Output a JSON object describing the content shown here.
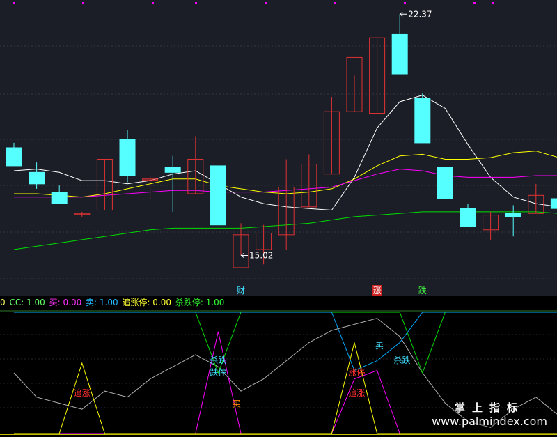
{
  "colors": {
    "background": "#000000",
    "upper_bg": "#1c1e27",
    "grid": "#353846",
    "divider": "#2e7a2e",
    "up": "#e03232",
    "down": "#55ffff",
    "ma1": "#ffffff",
    "ma2": "#ffff00",
    "ma3": "#ff00ff",
    "ma4": "#00dd00",
    "lower_white": "#b0b0b0",
    "buy_line": "#ff00ff",
    "sell_line": "#00aaff",
    "chase_line": "#ffff00",
    "kill_line": "#00dd00",
    "label_red": "#ff3030",
    "label_cyan": "#40e0ff",
    "label_orange": "#ff8800",
    "tag_green": "#40ff40",
    "tag_red_bg": "#cc2222",
    "legend_cc": "#66ff66",
    "legend_buy": "#ff33ff",
    "legend_sell": "#22bbff",
    "legend_chase": "#ffff33",
    "legend_kill": "#33ff33"
  },
  "legend": [
    {
      "text": "0",
      "color": "#ffff66"
    },
    {
      "text": "CC: 1.00",
      "color": "#66ff66"
    },
    {
      "text": "买: 0.00",
      "color": "#ff33ff"
    },
    {
      "text": "卖: 1.00",
      "color": "#22bbff"
    },
    {
      "text": "追涨停: 0.00",
      "color": "#ffff33"
    },
    {
      "text": "杀跌停: 1.00",
      "color": "#33ff33"
    }
  ],
  "watermark": {
    "line1": "掌上指标",
    "line2": "www.palmindex.com"
  },
  "chart_data": [
    {
      "type": "candlestick",
      "ylim": [
        13.8,
        22.8
      ],
      "x": [
        0,
        1,
        2,
        3,
        4,
        5,
        6,
        7,
        8,
        9,
        10,
        11,
        12,
        13,
        14,
        15,
        16,
        17,
        18,
        19,
        20,
        21,
        22,
        23,
        24,
        25
      ],
      "candles": [
        {
          "o": 18.3,
          "h": 18.45,
          "l": 17.75,
          "c": 17.75
        },
        {
          "o": 17.55,
          "h": 17.85,
          "l": 17.05,
          "c": 17.2
        },
        {
          "o": 16.95,
          "h": 17.15,
          "l": 16.65,
          "c": 16.6
        },
        {
          "o": 16.3,
          "h": 16.35,
          "l": 16.2,
          "c": 16.3
        },
        {
          "o": 16.4,
          "h": 17.95,
          "l": 16.4,
          "c": 17.95
        },
        {
          "o": 18.55,
          "h": 18.85,
          "l": 17.25,
          "c": 17.45
        },
        {
          "o": 17.35,
          "h": 17.45,
          "l": 16.7,
          "c": 17.35
        },
        {
          "o": 17.7,
          "h": 18.05,
          "l": 16.35,
          "c": 17.55
        },
        {
          "o": 16.9,
          "h": 18.65,
          "l": 16.9,
          "c": 17.95
        },
        {
          "o": 17.75,
          "h": 17.75,
          "l": 15.95,
          "c": 15.95
        },
        {
          "o": 14.65,
          "h": 16.0,
          "l": 15.02,
          "c": 15.65
        },
        {
          "o": 15.2,
          "h": 15.95,
          "l": 14.75,
          "c": 15.7
        },
        {
          "o": 15.65,
          "h": 17.95,
          "l": 15.2,
          "c": 17.1
        },
        {
          "o": 16.5,
          "h": 18.1,
          "l": 16.5,
          "c": 17.8
        },
        {
          "o": 17.5,
          "h": 19.85,
          "l": 17.5,
          "c": 19.4
        },
        {
          "o": 19.4,
          "h": 20.5,
          "l": 19.4,
          "c": 21.05
        },
        {
          "o": 19.35,
          "h": 21.65,
          "l": 19.35,
          "c": 21.65
        },
        {
          "o": 21.75,
          "h": 22.37,
          "l": 20.55,
          "c": 20.55
        },
        {
          "o": 19.8,
          "h": 19.95,
          "l": 18.45,
          "c": 18.45
        },
        {
          "o": 17.7,
          "h": 17.7,
          "l": 17.15,
          "c": 16.75
        },
        {
          "o": 16.45,
          "h": 16.6,
          "l": 16.2,
          "c": 15.9
        },
        {
          "o": 15.8,
          "h": 16.35,
          "l": 15.5,
          "c": 16.25
        },
        {
          "o": 16.3,
          "h": 16.55,
          "l": 15.6,
          "c": 16.2
        },
        {
          "o": 16.3,
          "h": 17.2,
          "l": 16.3,
          "c": 16.85
        },
        {
          "o": 16.75,
          "h": 16.75,
          "l": 16.45,
          "c": 16.45
        },
        {
          "o": 16.3,
          "h": 16.5,
          "l": 15.95,
          "c": 15.95
        }
      ],
      "moving_averages": [
        {
          "color_key": "ma1",
          "values": [
            17.6,
            17.65,
            17.55,
            17.3,
            17.3,
            17.2,
            17.3,
            17.5,
            17.6,
            17.2,
            16.8,
            16.6,
            16.5,
            16.45,
            16.4,
            17.4,
            18.9,
            19.7,
            19.9,
            19.5,
            18.4,
            17.4,
            16.8,
            16.6,
            16.5,
            16.45
          ]
        },
        {
          "color_key": "ma2",
          "values": [
            16.9,
            16.9,
            16.85,
            16.8,
            16.9,
            17.05,
            17.2,
            17.35,
            17.35,
            17.15,
            17.05,
            16.95,
            16.9,
            16.95,
            17.05,
            17.35,
            17.75,
            18.05,
            18.1,
            17.95,
            17.95,
            18.0,
            18.15,
            18.2,
            18.0,
            17.9
          ]
        },
        {
          "color_key": "ma3",
          "values": [
            16.8,
            16.8,
            16.8,
            16.8,
            16.85,
            16.9,
            16.95,
            17.0,
            17.0,
            16.95,
            16.95,
            16.95,
            17.0,
            17.05,
            17.1,
            17.3,
            17.5,
            17.65,
            17.6,
            17.45,
            17.4,
            17.4,
            17.4,
            17.45,
            17.45,
            17.4
          ]
        },
        {
          "color_key": "ma4",
          "values": [
            15.2,
            15.3,
            15.4,
            15.5,
            15.6,
            15.7,
            15.8,
            15.85,
            15.85,
            15.85,
            15.85,
            15.9,
            15.95,
            16.0,
            16.1,
            16.2,
            16.25,
            16.3,
            16.35,
            16.35,
            16.35,
            16.35,
            16.35,
            16.35,
            16.3,
            16.3
          ]
        }
      ],
      "annotations": [
        {
          "text": "22.37",
          "index": 17,
          "value": 22.37
        },
        {
          "text": "15.02",
          "index": 10,
          "value": 15.02
        }
      ],
      "tags": [
        {
          "text": "财",
          "index": 10,
          "style": "cyan"
        },
        {
          "text": "涨",
          "index": 16,
          "style": "redbox"
        },
        {
          "text": "跌",
          "index": 18,
          "style": "green"
        }
      ]
    },
    {
      "type": "line",
      "ylim": [
        0,
        1
      ],
      "series": [
        {
          "color_key": "lower_white",
          "values": [
            0.5,
            0.3,
            0.25,
            0.2,
            0.35,
            0.3,
            0.45,
            0.55,
            0.65,
            0.55,
            0.35,
            0.45,
            0.6,
            0.75,
            0.85,
            0.9,
            0.95,
            0.8,
            0.5,
            0.25,
            0.1,
            0.05,
            0.2,
            0.3,
            0.15,
            0.1
          ]
        },
        {
          "color_key": "kill_line",
          "values": [
            1,
            1,
            1,
            1,
            1,
            1,
            1,
            1,
            1,
            0.5,
            1,
            1,
            1,
            1,
            1,
            1,
            1,
            1,
            0.5,
            1,
            1,
            1,
            1,
            1,
            1,
            1
          ]
        },
        {
          "color_key": "sell_line",
          "values": [
            1,
            1,
            1,
            1,
            1,
            1,
            1,
            1,
            1,
            1,
            1,
            1,
            1,
            1,
            1,
            0.52,
            0.6,
            0.75,
            1,
            1,
            1,
            1,
            1,
            1,
            1,
            1
          ]
        },
        {
          "color_key": "buy_line",
          "values": [
            0,
            0,
            0,
            0,
            0,
            0,
            0,
            0,
            0,
            0.84,
            0,
            0,
            0,
            0,
            0,
            0.45,
            0.52,
            0,
            0,
            0,
            0,
            0,
            0,
            0,
            0,
            0
          ]
        },
        {
          "color_key": "chase_line",
          "values": [
            0,
            0,
            0,
            0.58,
            0,
            0,
            0,
            0,
            0,
            0,
            0,
            0,
            0,
            0,
            0,
            0.75,
            0,
            0,
            0,
            0,
            0,
            0,
            0,
            0,
            0,
            0
          ]
        }
      ],
      "labels": [
        {
          "text": "追涨",
          "index": 3,
          "value": 0.31,
          "color_key": "label_red"
        },
        {
          "text": "杀跌",
          "index": 9,
          "value": 0.58,
          "color_key": "label_cyan"
        },
        {
          "text": "跌停",
          "index": 9,
          "value": 0.48,
          "color_key": "label_cyan"
        },
        {
          "text": "买",
          "index": 9.8,
          "value": 0.22,
          "color_key": "label_orange"
        },
        {
          "text": "涨停",
          "index": 15.1,
          "value": 0.48,
          "color_key": "label_red"
        },
        {
          "text": "追涨",
          "index": 15.1,
          "value": 0.31,
          "color_key": "label_red"
        },
        {
          "text": "卖",
          "index": 16.1,
          "value": 0.7,
          "color_key": "label_cyan"
        },
        {
          "text": "杀跌",
          "index": 17.1,
          "value": 0.58,
          "color_key": "label_cyan"
        }
      ]
    }
  ]
}
